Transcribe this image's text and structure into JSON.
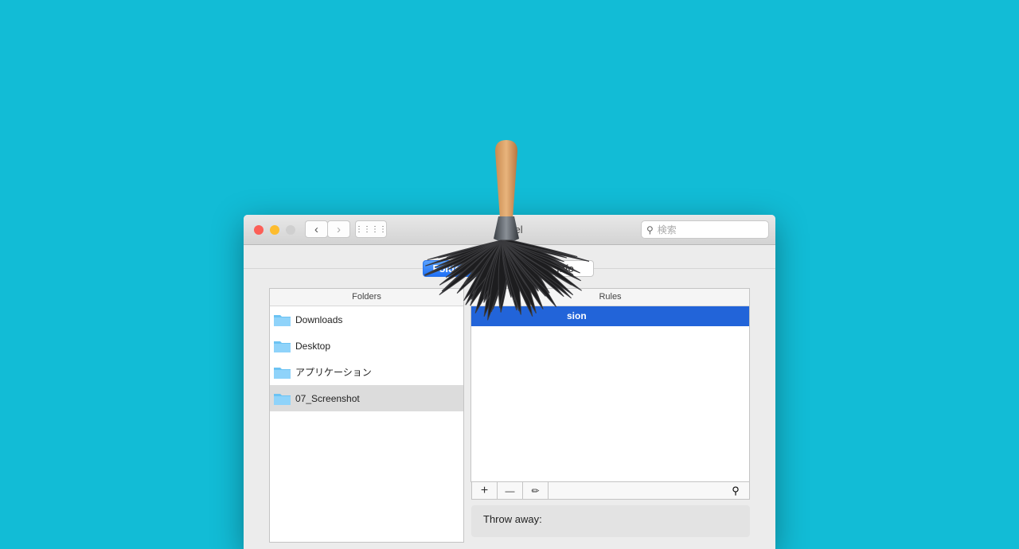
{
  "window": {
    "title": "Hazel",
    "search_placeholder": "検索"
  },
  "tabs": [
    {
      "label": "Folders",
      "selected": true
    },
    {
      "label": "",
      "selected": false
    },
    {
      "label": "Info",
      "selected": false
    }
  ],
  "folders": {
    "header": "Folders",
    "items": [
      {
        "name": "Downloads",
        "icon": "downloads-folder-icon"
      },
      {
        "name": "Desktop",
        "icon": "desktop-folder-icon"
      },
      {
        "name": "アプリケーション",
        "icon": "applications-folder-icon"
      },
      {
        "name": "07_Screenshot",
        "icon": "folder-icon",
        "selected": true
      }
    ]
  },
  "rules": {
    "header": "Rules",
    "items": [
      {
        "name": "sion",
        "selected": true
      }
    ],
    "toolbar": {
      "add": "+",
      "remove": "—"
    }
  },
  "throw_away": {
    "label": "Throw away:"
  },
  "colors": {
    "background": "#12bcd6",
    "accent": "#2264d9"
  }
}
